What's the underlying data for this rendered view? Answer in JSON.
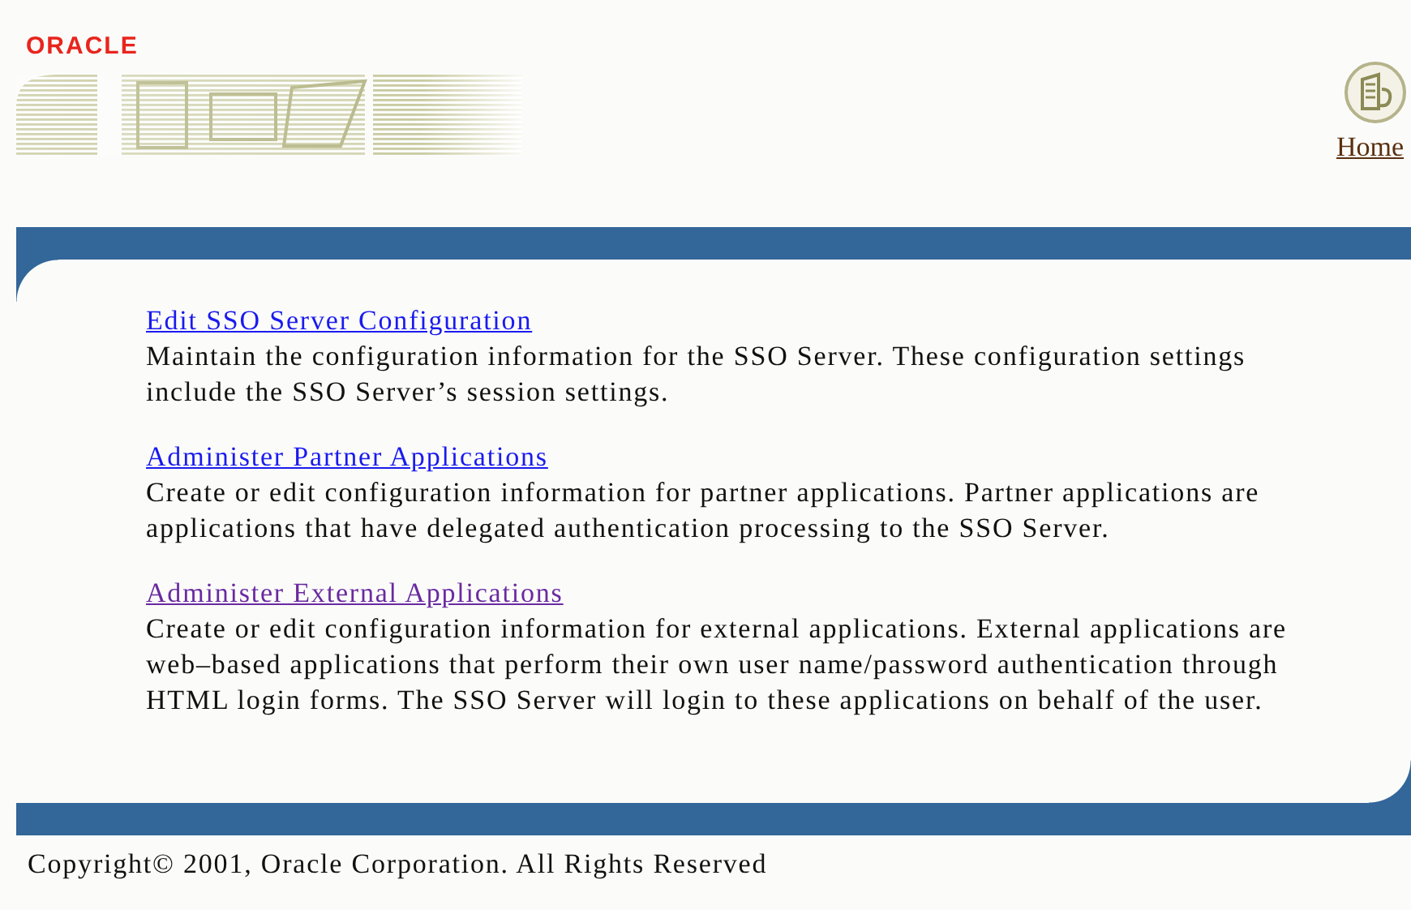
{
  "header": {
    "logo": "ORACLE",
    "home_link": "Home"
  },
  "sections": [
    {
      "link": "Edit SSO Server Configuration",
      "visited": false,
      "description": "Maintain the configuration information for the SSO Server. These configuration settings include the SSO Server’s session settings."
    },
    {
      "link": "Administer Partner Applications",
      "visited": false,
      "description": "Create or edit configuration information for partner applications. Partner applications are applications that have delegated authentication processing to the SSO Server."
    },
    {
      "link": "Administer External Applications",
      "visited": true,
      "description": "Create or edit configuration information for external applications. External applications are web–based applications that perform their own user name/password authentication through HTML login forms. The SSO Server will login to these applications on behalf of the user."
    }
  ],
  "footer": {
    "copyright": "Copyright© 2001, Oracle Corporation. All Rights Reserved"
  }
}
